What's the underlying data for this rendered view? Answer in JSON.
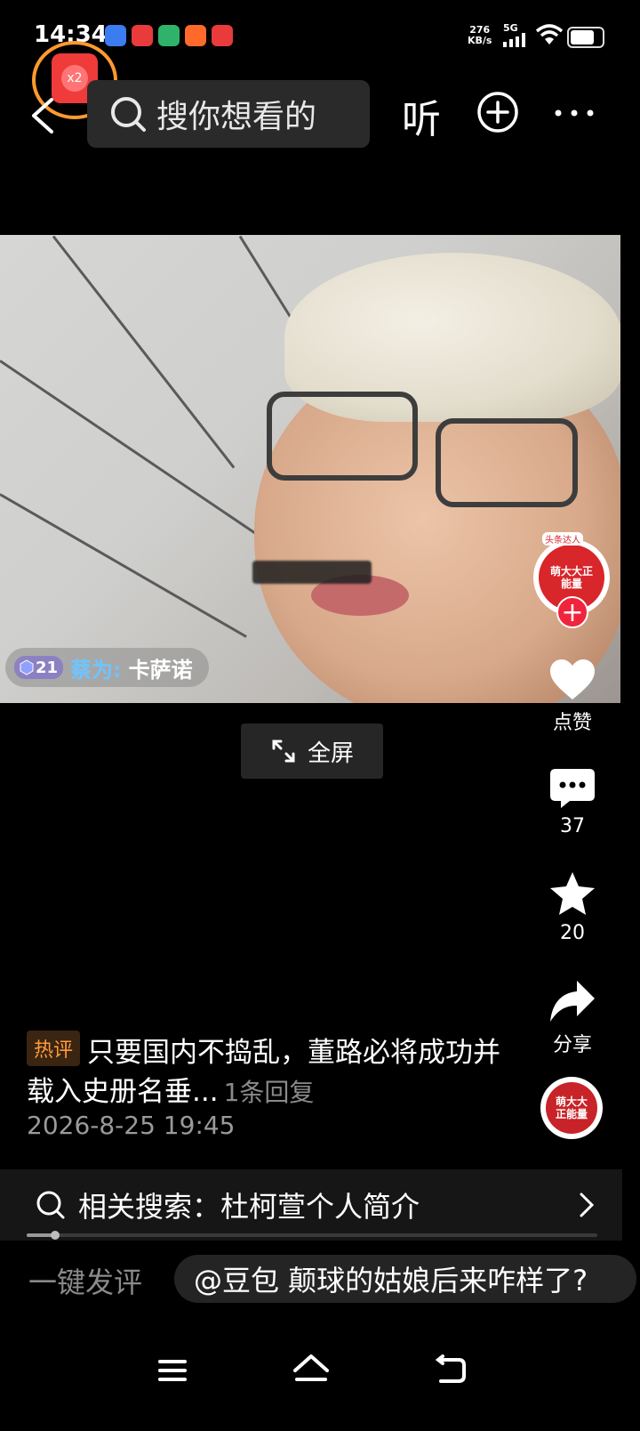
{
  "status_bar": {
    "time": "14:34",
    "net_speed_value": "276",
    "net_speed_unit": "KB/s",
    "network": "5G",
    "battery_level": 0.75,
    "app_icons": [
      "browser-icon",
      "toutiao-icon",
      "app-icon",
      "app-icon",
      "toutiao-icon"
    ]
  },
  "top_nav": {
    "red_packet_badge": "x2",
    "search_placeholder": "搜你想看的",
    "listen_label": "听"
  },
  "video": {
    "danmu_level": "21",
    "danmu_user": "蔡为:",
    "danmu_text": "卡萨诺",
    "fullscreen_label": "全屏"
  },
  "creator": {
    "tag": "头条达人",
    "avatar_text": "萌大大正能量"
  },
  "actions": {
    "like_label": "点赞",
    "comment_count": "37",
    "favorite_count": "20",
    "share_label": "分享"
  },
  "hot_comment": {
    "tag": "热评",
    "text": "只要国内不捣乱，董路必将成功并载入史册名垂...",
    "replies": "1条回复",
    "date": "2026-8-25 19:45"
  },
  "related_search": {
    "text": "相关搜索：杜柯萱个人简介",
    "progress": 0.05
  },
  "comment_bar": {
    "quick_comment": "一键发评",
    "ai_suggestion": "@豆包 颠球的姑娘后来咋样了?"
  },
  "colors": {
    "background": "#000000",
    "accent_red": "#f0253d",
    "hot_tag": "#ff9b3b",
    "danmu_user": "#6fc4ff"
  }
}
